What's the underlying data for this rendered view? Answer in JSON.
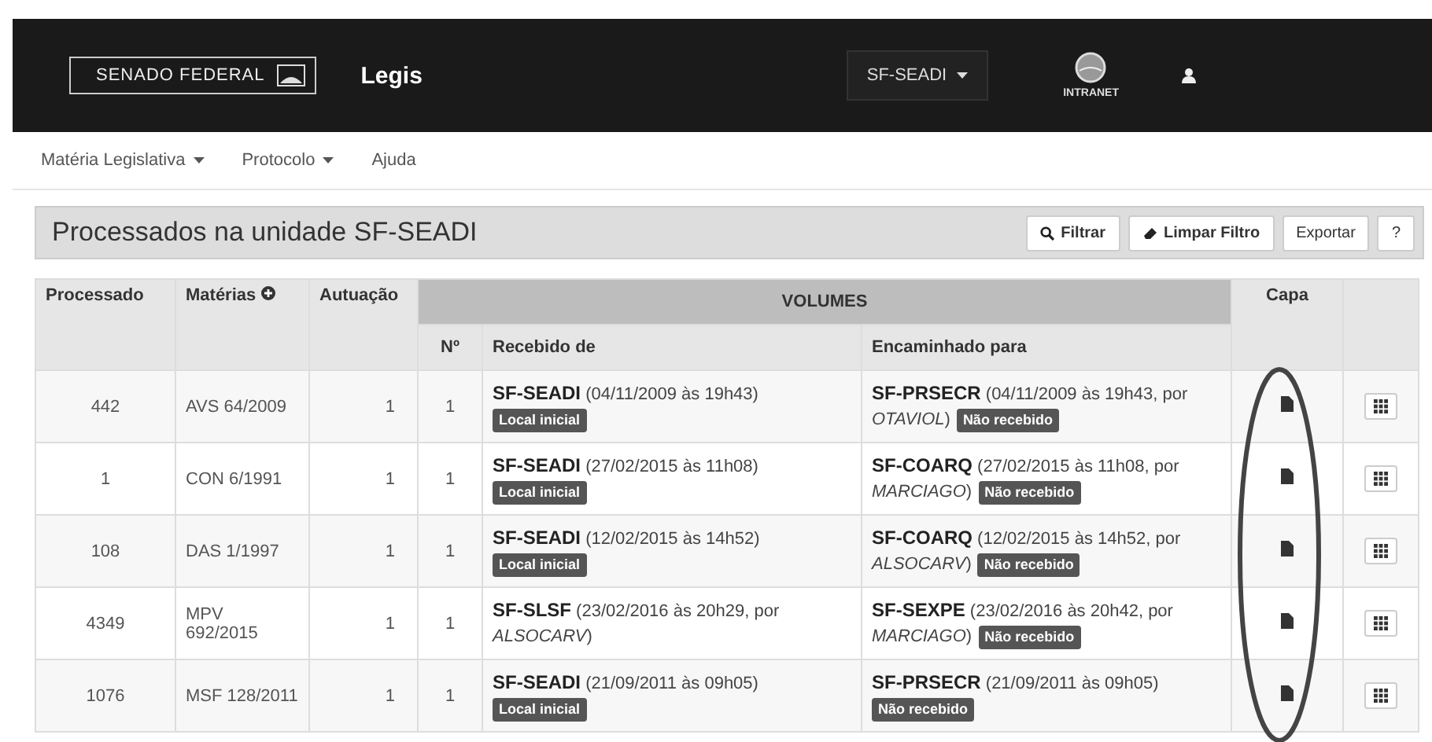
{
  "header": {
    "logo_text": "SENADO FEDERAL",
    "app_name": "Legis",
    "unit_selector": "SF-SEADI",
    "intranet_label": "INTRANET"
  },
  "menu": [
    {
      "label": "Matéria Legislativa",
      "dropdown": true
    },
    {
      "label": "Protocolo",
      "dropdown": true
    },
    {
      "label": "Ajuda",
      "dropdown": false
    }
  ],
  "panel": {
    "title": "Processados na unidade SF-SEADI",
    "buttons": [
      {
        "label": "Filtrar",
        "kind": "search"
      },
      {
        "label": "Limpar Filtro",
        "kind": "eraser"
      },
      {
        "label": "Exportar",
        "kind": "plain"
      },
      {
        "label": "?",
        "kind": "plain"
      }
    ]
  },
  "table": {
    "columns": [
      "Processado",
      "Matérias",
      "Autuação"
    ],
    "group": "VOLUMES",
    "sub_columns": [
      "Nº",
      "Recebido de",
      "Encaminhado para"
    ],
    "capa": "Capa",
    "rows": [
      {
        "processado": "442",
        "materia": "AVS 64/2009",
        "autuacao": "1",
        "numero": "1",
        "recebido": [
          "**SF-SEADI** (04/11/2009 às 19h43)"
        ],
        "recebido_badge": "Local inicial",
        "encaminhado": [
          "**SF-PRSECR** (04/11/2009 às 19h43, por",
          "*OTAVIOL*)"
        ],
        "encaminhado_badge": "Não recebido"
      },
      {
        "processado": "1",
        "materia": "CON 6/1991",
        "autuacao": "1",
        "numero": "1",
        "recebido": [
          "**SF-SEADI** (27/02/2015 às 11h08)"
        ],
        "recebido_badge": "Local inicial",
        "encaminhado": [
          "**SF-COARQ** (27/02/2015 às 11h08, por",
          "*MARCIAGO*)"
        ],
        "encaminhado_badge": "Não recebido"
      },
      {
        "processado": "108",
        "materia": "DAS 1/1997",
        "autuacao": "1",
        "numero": "1",
        "recebido": [
          "**SF-SEADI** (12/02/2015 às 14h52)"
        ],
        "recebido_badge": "Local inicial",
        "encaminhado": [
          "**SF-COARQ** (12/02/2015 às 14h52, por",
          "*ALSOCARV*)"
        ],
        "encaminhado_badge": "Não recebido"
      },
      {
        "processado": "4349",
        "materia": "MPV 692/2015",
        "autuacao": "1",
        "numero": "1",
        "recebido": [
          "**SF-SLSF** (23/02/2016 às 20h29, por",
          "*ALSOCARV*)"
        ],
        "encaminhado": [
          "**SF-SEXPE** (23/02/2016 às 20h42, por",
          "*MARCIAGO*)"
        ],
        "encaminhado_badge": "Não recebido"
      },
      {
        "processado": "1076",
        "materia": "MSF 128/2011",
        "autuacao": "1",
        "numero": "1",
        "recebido": [
          "**SF-SEADI** (21/09/2011 às 09h05)"
        ],
        "recebido_badge": "Local inicial",
        "encaminhado": [
          "**SF-PRSECR** (21/09/2011 às 09h05)"
        ],
        "encaminhado_badge": "Não recebido"
      }
    ]
  }
}
